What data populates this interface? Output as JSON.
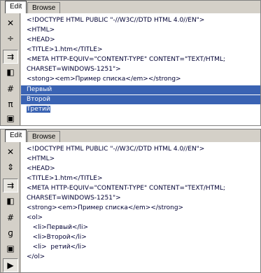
{
  "top_pane": {
    "tabs": {
      "edit": "Edit",
      "browse": "Browse"
    },
    "lines": [
      "<!DOCTYPE HTML PUBLIC \"-//W3C//DTD HTML 4.0//EN\">",
      "<HTML>",
      "<HEAD>",
      "<TITLE>1.htm</TITLE>",
      "<META HTTP-EQUIV=\"CONTENT-TYPE\" CONTENT=\"TEXT/HTML;",
      "CHARSET=WINDOWS-1251\">",
      "<stong><em>Пример списка</em></strong>",
      "Первый",
      "Второй",
      "Третий"
    ]
  },
  "bottom_pane": {
    "tabs": {
      "edit": "Edit",
      "browse": "Browse"
    },
    "lines": [
      "<!DOCTYPE HTML PUBLIC \"-//W3C//DTD HTML 4.0//EN\">",
      "<HTML>",
      "<HEAD>",
      "<TITLE>1.htm</TITLE>",
      "<META HTTP-EQUIV=\"CONTENT-TYPE\" CONTENT=\"TEXT/HTML;",
      "CHARSET=WINDOWS-1251\">",
      "<strong><em>Пример списка</em></strong>",
      "<ol>",
      "   <li>Первый</li>",
      "   <li>Второй</li>",
      "   <li>  ретий</li>",
      "</ol>"
    ]
  },
  "toolbar": {
    "icons": [
      "close-icon",
      "split-icon",
      "wrap-icon",
      "indent-icon",
      "hash-icon",
      "pi-icon",
      "monitor-icon",
      "play-icon"
    ],
    "glyphs": {
      "close": "✕",
      "split": "÷",
      "split_alt": "⇕",
      "wrap": "⇉",
      "indent": "◧",
      "hash": "#",
      "pi": "π",
      "gamma": "ɡ",
      "monitor": "▣",
      "play": "▶"
    }
  }
}
